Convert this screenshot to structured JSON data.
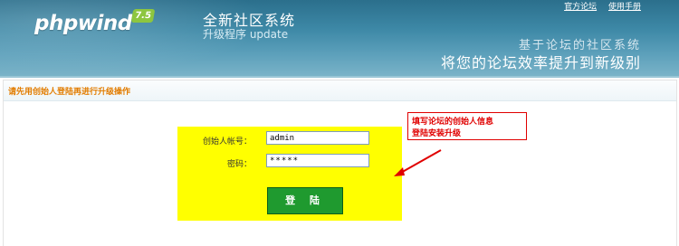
{
  "header": {
    "logo_text": "phpwind",
    "version_badge": "7.5",
    "title_main": "全新社区系统",
    "title_sub": "升级程序 update",
    "links": [
      {
        "label": "官方论坛"
      },
      {
        "label": "使用手册"
      }
    ],
    "slogan_line1": "基于论坛的社区系统",
    "slogan_line2": "将您的论坛效率提升到新级别"
  },
  "panel": {
    "heading": "请先用创始人登陆再进行升级操作"
  },
  "login": {
    "username_label": "创始人帐号：",
    "username_value": "admin",
    "password_label": "密码：",
    "password_value": "*****",
    "submit_label": "登 陆"
  },
  "annotation": {
    "line1": "填写论坛的创始人信息",
    "line2": "登陆安装升级",
    "color": "#e00000"
  },
  "colors": {
    "header": "#3d88a6",
    "highlight": "#ffff00",
    "button": "#1f9a2f",
    "heading_text": "#e27c00"
  }
}
